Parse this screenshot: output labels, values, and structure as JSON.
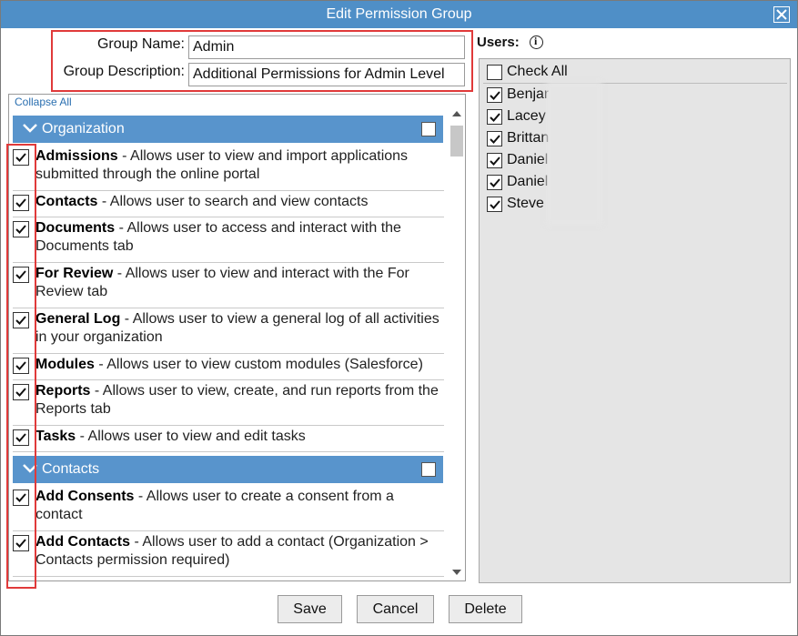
{
  "window": {
    "title": "Edit Permission Group"
  },
  "form": {
    "group_name_label": "Group Name:",
    "group_name_value": "Admin",
    "group_description_label": "Group Description:",
    "group_description_value": "Additional Permissions for Admin Level"
  },
  "permissions": {
    "collapse_all": "Collapse All",
    "groups": [
      {
        "title": "Organization",
        "checked": false,
        "items": [
          {
            "name": "Admissions",
            "desc": " - Allows user to view and import applications submitted through the online portal",
            "checked": true
          },
          {
            "name": "Contacts",
            "desc": " - Allows user to search and view contacts",
            "checked": true
          },
          {
            "name": "Documents",
            "desc": " - Allows user to access and interact with the Documents tab",
            "checked": true
          },
          {
            "name": "For Review",
            "desc": " - Allows user to view and interact with the For Review tab",
            "checked": true
          },
          {
            "name": "General Log",
            "desc": " - Allows user to view a general log of all activities in your organization",
            "checked": true
          },
          {
            "name": "Modules",
            "desc": " - Allows user to view custom modules (Salesforce)",
            "checked": true
          },
          {
            "name": "Reports",
            "desc": " - Allows user to view, create, and run reports from the Reports tab",
            "checked": true
          },
          {
            "name": "Tasks",
            "desc": " - Allows user to view and edit tasks",
            "checked": true
          }
        ]
      },
      {
        "title": "Contacts",
        "checked": false,
        "items": [
          {
            "name": "Add Consents",
            "desc": " - Allows user to create a consent from a contact",
            "checked": true
          },
          {
            "name": "Add Contacts",
            "desc": " - Allows user to add a contact (Organization > Contacts permission required)",
            "checked": true
          }
        ]
      }
    ]
  },
  "users": {
    "label": "Users:",
    "check_all": "Check All",
    "check_all_checked": false,
    "list": [
      {
        "name": "Benjar",
        "checked": true
      },
      {
        "name": "Lacey",
        "checked": true
      },
      {
        "name": "Brittan",
        "checked": true
      },
      {
        "name": "Daniel",
        "checked": true
      },
      {
        "name": "Daniel",
        "checked": true
      },
      {
        "name": "Steve",
        "checked": true
      }
    ]
  },
  "buttons": {
    "save": "Save",
    "cancel": "Cancel",
    "delete": "Delete"
  },
  "colors": {
    "titlebar": "#4f8fc7",
    "group_header": "#5894cc",
    "highlight": "#e03a3a",
    "users_bg": "#e5e5e5"
  }
}
